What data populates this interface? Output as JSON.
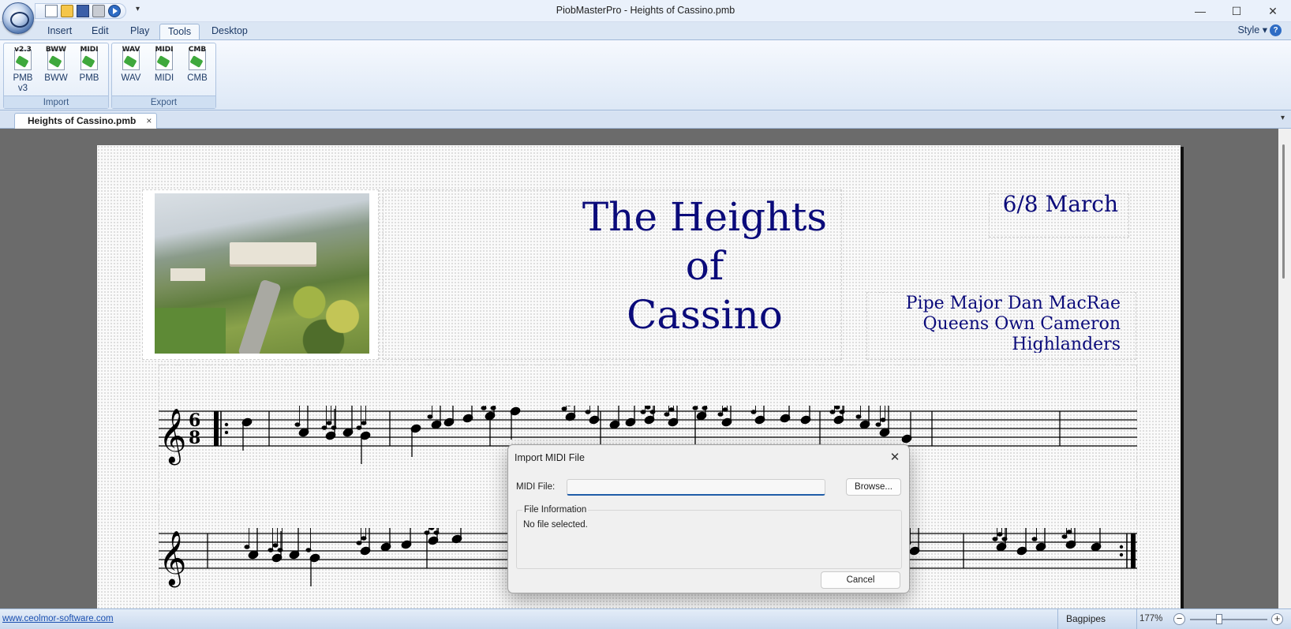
{
  "window": {
    "title": "PiobMasterPro - Heights of Cassino.pmb",
    "minimize": "—",
    "maximize": "☐",
    "close": "✕"
  },
  "quick_access": {
    "icons": [
      "new-icon",
      "open-icon",
      "save-icon",
      "print-icon",
      "play-icon"
    ],
    "dropdown": "▾"
  },
  "ribbon": {
    "tabs": [
      {
        "label": "Insert"
      },
      {
        "label": "Edit"
      },
      {
        "label": "Play"
      },
      {
        "label": "Tools",
        "active": true
      },
      {
        "label": "Desktop"
      }
    ],
    "style_label": "Style ▾",
    "help": "?",
    "groups": [
      {
        "label": "Import",
        "buttons": [
          {
            "tag": "v2.3",
            "label": "PMB v3"
          },
          {
            "tag": "BWW",
            "label": "BWW"
          },
          {
            "tag": "MIDI",
            "label": "PMB"
          }
        ]
      },
      {
        "label": "Export",
        "buttons": [
          {
            "tag": "WAV",
            "label": "WAV"
          },
          {
            "tag": "MIDI",
            "label": "MIDI"
          },
          {
            "tag": "CMB",
            "label": "CMB"
          }
        ]
      }
    ]
  },
  "document_tab": {
    "label": "Heights of Cassino.pmb",
    "close": "×",
    "dropdown": "▾"
  },
  "score": {
    "title_lines": [
      "The Heights",
      "of",
      "Cassino"
    ],
    "meter": "6/8 March",
    "composer_lines": [
      "Pipe Major Dan MacRae",
      "Queens Own Cameron",
      "Highlanders"
    ],
    "time_signature": {
      "top": "6",
      "bottom": "8"
    }
  },
  "dialog": {
    "title": "Import MIDI File",
    "close": "✕",
    "midi_file_label": "MIDI File:",
    "midi_file_value": "",
    "browse_label": "Browse...",
    "file_info_legend": "File Information",
    "file_info_text": "No file selected.",
    "cancel_label": "Cancel"
  },
  "statusbar": {
    "link": "www.ceolmor-software.com",
    "instrument": "Bagpipes",
    "zoom": "177%",
    "zoom_out": "−",
    "zoom_in": "+",
    "zoom_fraction": 0.38
  }
}
